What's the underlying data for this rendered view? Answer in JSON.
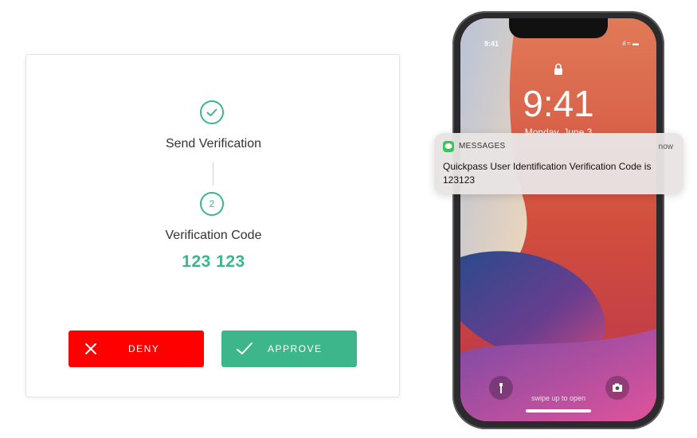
{
  "verification": {
    "step1_label": "Send Verification",
    "step2_number": "2",
    "step2_label": "Verification Code",
    "code": "123 123",
    "deny_label": "DENY",
    "approve_label": "APPROVE"
  },
  "phone": {
    "status_time": "9:41",
    "lock_time": "9:41",
    "lock_date": "Monday, June 3",
    "swipe_hint": "swipe up to open",
    "status_icons": "ıl ≈ ▬"
  },
  "notification": {
    "app_name": "MESSAGES",
    "time": "now",
    "body": "Quickpass User Identification Verification Code is 123123"
  },
  "colors": {
    "accent_green": "#3db68c",
    "deny_red": "#ff0000",
    "messages_green": "#34c759"
  },
  "icons": [
    "check-circle-icon",
    "close-icon",
    "check-icon",
    "lock-icon",
    "flashlight-icon",
    "camera-icon",
    "messages-app-icon"
  ]
}
